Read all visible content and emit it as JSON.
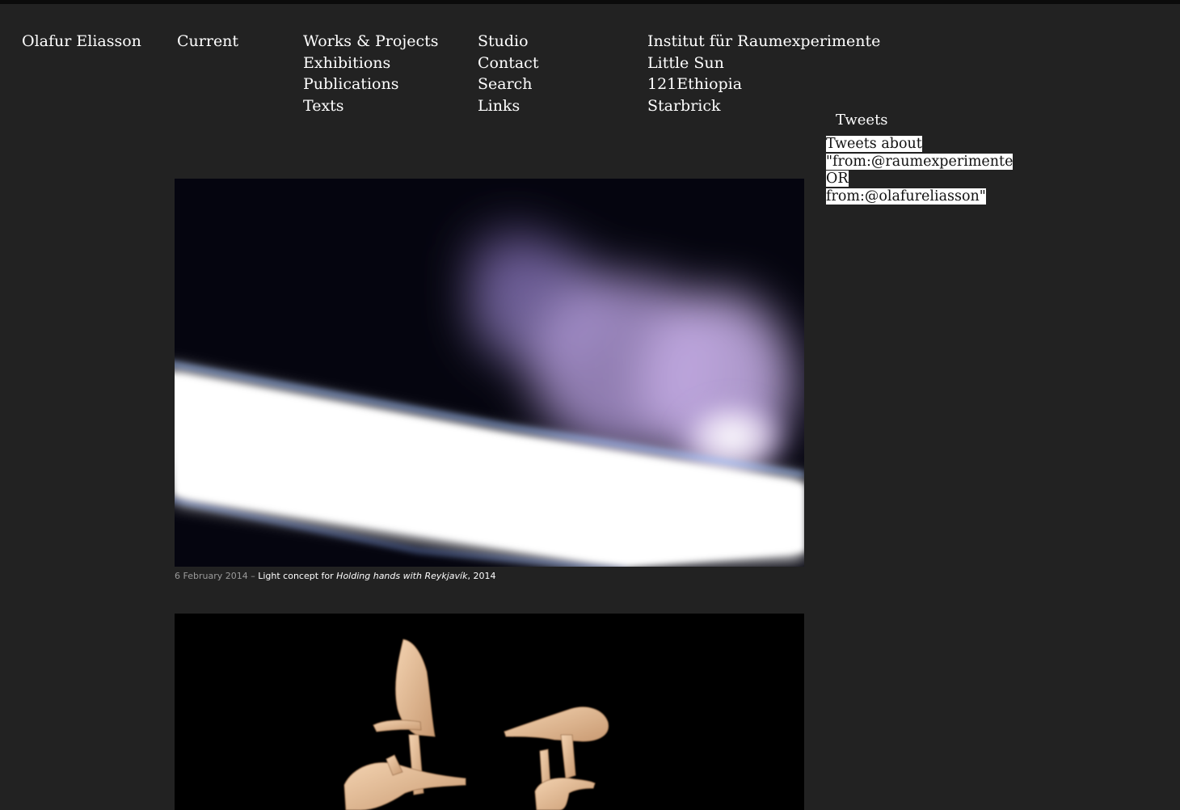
{
  "site_title": "Olafur Eliasson",
  "nav": {
    "current": "Current",
    "col1": [
      "Works & Projects",
      "Exhibitions",
      "Publications",
      "Texts"
    ],
    "col2": [
      "Studio",
      "Contact",
      "Search",
      "Links"
    ],
    "col3": [
      "Institut für Raumexperimente",
      "Little Sun",
      "121Ethiopia",
      "Starbrick"
    ]
  },
  "tweets": {
    "heading": "Tweets",
    "line1": "Tweets about",
    "line2": "\"from:@raumexperimente OR",
    "line3": "from:@olafureliasson\""
  },
  "posts": [
    {
      "date": "6 February 2014",
      "separator": " – ",
      "caption_prefix": "Light concept for ",
      "caption_title": "Holding hands with Reykjavík",
      "caption_suffix": ", 2014"
    }
  ],
  "colors": {
    "background": "#222222",
    "top_bar": "#0b0b0b",
    "text": "#ffffff",
    "caption_date": "#9a9a9a"
  }
}
